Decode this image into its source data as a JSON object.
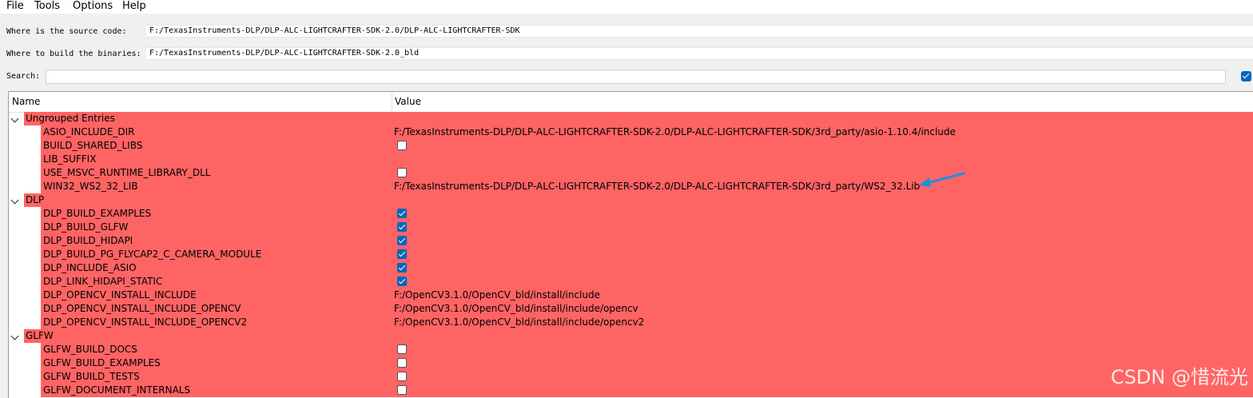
{
  "menu": [
    "File",
    "Tools",
    "Options",
    "Help"
  ],
  "source": {
    "label": "Where is the source code:",
    "value": "F:/TexasInstruments-DLP/DLP-ALC-LIGHTCRAFTER-SDK-2.0/DLP-ALC-LIGHTCRAFTER-SDK"
  },
  "build": {
    "label": "Where to build the binaries:",
    "value": "F:/TexasInstruments-DLP/DLP-ALC-LIGHTCRAFTER-SDK-2.0_bld"
  },
  "search": {
    "label": "Search:",
    "value": ""
  },
  "table": {
    "headers": {
      "name": "Name",
      "value": "Value"
    },
    "groups": [
      {
        "label": "Ungrouped Entries",
        "entries": [
          {
            "name": "ASIO_INCLUDE_DIR",
            "type": "text",
            "value": "F:/TexasInstruments-DLP/DLP-ALC-LIGHTCRAFTER-SDK-2.0/DLP-ALC-LIGHTCRAFTER-SDK/3rd_party/asio-1.10.4/include"
          },
          {
            "name": "BUILD_SHARED_LIBS",
            "type": "bool",
            "checked": false
          },
          {
            "name": "LIB_SUFFIX",
            "type": "text",
            "value": ""
          },
          {
            "name": "USE_MSVC_RUNTIME_LIBRARY_DLL",
            "type": "bool",
            "checked": false
          },
          {
            "name": "WIN32_WS2_32_LIB",
            "type": "text",
            "value": "F:/TexasInstruments-DLP/DLP-ALC-LIGHTCRAFTER-SDK-2.0/DLP-ALC-LIGHTCRAFTER-SDK/3rd_party/WS2_32.Lib"
          }
        ]
      },
      {
        "label": "DLP",
        "entries": [
          {
            "name": "DLP_BUILD_EXAMPLES",
            "type": "bool",
            "checked": true
          },
          {
            "name": "DLP_BUILD_GLFW",
            "type": "bool",
            "checked": true
          },
          {
            "name": "DLP_BUILD_HIDAPI",
            "type": "bool",
            "checked": true
          },
          {
            "name": "DLP_BUILD_PG_FLYCAP2_C_CAMERA_MODULE",
            "type": "bool",
            "checked": true
          },
          {
            "name": "DLP_INCLUDE_ASIO",
            "type": "bool",
            "checked": true
          },
          {
            "name": "DLP_LINK_HIDAPI_STATIC",
            "type": "bool",
            "checked": true
          },
          {
            "name": "DLP_OPENCV_INSTALL_INCLUDE",
            "type": "text",
            "value": "F:/OpenCV3.1.0/OpenCV_bld/install/include"
          },
          {
            "name": "DLP_OPENCV_INSTALL_INCLUDE_OPENCV",
            "type": "text",
            "value": "F:/OpenCV3.1.0/OpenCV_bld/install/include/opencv"
          },
          {
            "name": "DLP_OPENCV_INSTALL_INCLUDE_OPENCV2",
            "type": "text",
            "value": "F:/OpenCV3.1.0/OpenCV_bld/install/include/opencv2"
          }
        ]
      },
      {
        "label": "GLFW",
        "entries": [
          {
            "name": "GLFW_BUILD_DOCS",
            "type": "bool",
            "checked": false
          },
          {
            "name": "GLFW_BUILD_EXAMPLES",
            "type": "bool",
            "checked": false
          },
          {
            "name": "GLFW_BUILD_TESTS",
            "type": "bool",
            "checked": false
          },
          {
            "name": "GLFW_DOCUMENT_INTERNALS",
            "type": "bool",
            "checked": false
          }
        ]
      }
    ]
  },
  "colors": {
    "highlight": "#ff6464",
    "accent": "#0067c0",
    "annotation_arrow": "#1e90dc"
  },
  "watermark": "CSDN @惜流光"
}
